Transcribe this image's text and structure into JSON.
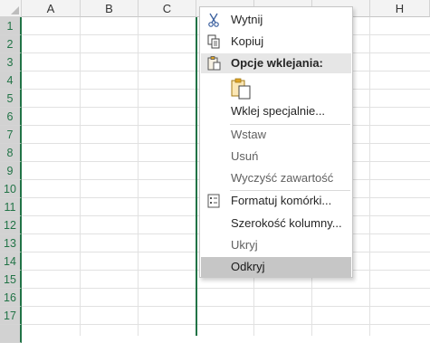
{
  "spreadsheet": {
    "columns": [
      "A",
      "B",
      "C",
      "",
      "",
      "",
      "H"
    ],
    "rows": [
      "1",
      "2",
      "3",
      "4",
      "5",
      "6",
      "7",
      "8",
      "9",
      "10",
      "11",
      "12",
      "13",
      "14",
      "15",
      "16",
      "17"
    ]
  },
  "context_menu": {
    "cut": "Wytnij",
    "copy": "Kopiuj",
    "paste_options_header": "Opcje wklejania:",
    "paste_special": "Wklej specjalnie...",
    "insert": "Wstaw",
    "delete": "Usuń",
    "clear_contents": "Wyczyść zawartość",
    "format_cells": "Formatuj komórki...",
    "column_width": "Szerokość kolumny...",
    "hide": "Ukryj",
    "unhide": "Odkryj"
  },
  "colors": {
    "selection_accent": "#217346",
    "hover_background": "#c6c6c6",
    "paste_icon": "#e0a526"
  }
}
